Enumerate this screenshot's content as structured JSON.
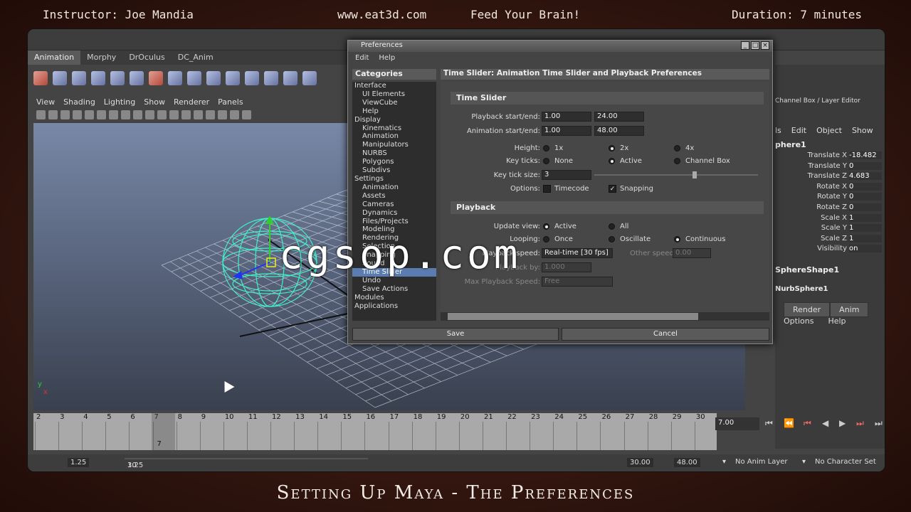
{
  "banner": {
    "instructor": "Instructor: Joe Mandia",
    "site": "www.eat3d.com",
    "tagline": "Feed Your Brain!",
    "duration": "Duration: 7 minutes",
    "lesson_title": "Setting Up Maya - The Preferences"
  },
  "watermark": "cgsop.com",
  "maya": {
    "shelf_tabs": [
      "Animation",
      "Morphy",
      "DrOculus",
      "DC_Anim"
    ],
    "active_shelf": "Animation",
    "viewport_menu": [
      "View",
      "Shading",
      "Lighting",
      "Show",
      "Renderer",
      "Panels"
    ],
    "axis_y": "y",
    "axis_x": "x",
    "channel_box": {
      "title": "Channel Box / Layer Editor",
      "menu": [
        "ls",
        "Edit",
        "Object",
        "Show"
      ],
      "object_name": "phere1",
      "attributes": [
        {
          "name": "Translate X",
          "value": "-18.482"
        },
        {
          "name": "Translate Y",
          "value": "0"
        },
        {
          "name": "Translate Z",
          "value": "4.683"
        },
        {
          "name": "Rotate X",
          "value": "0"
        },
        {
          "name": "Rotate Y",
          "value": "0"
        },
        {
          "name": "Rotate Z",
          "value": "0"
        },
        {
          "name": "Scale X",
          "value": "1"
        },
        {
          "name": "Scale Y",
          "value": "1"
        },
        {
          "name": "Scale Z",
          "value": "1"
        },
        {
          "name": "Visibility",
          "value": "on"
        }
      ],
      "shape_name": "SphereShape1",
      "input_name": "NurbSphere1"
    },
    "layer_editor": {
      "tabs": [
        "Render",
        "Anim"
      ],
      "menu": [
        "Options",
        "Help"
      ]
    },
    "timeline": {
      "ticks": [
        "2",
        "3",
        "4",
        "5",
        "6",
        "7",
        "8",
        "9",
        "10",
        "11",
        "12",
        "13",
        "14",
        "15",
        "16",
        "17",
        "18",
        "19",
        "20",
        "21",
        "22",
        "23",
        "24",
        "25",
        "26",
        "27",
        "28",
        "29",
        "30"
      ],
      "current_frame": "7",
      "current_frame_field": "7.00"
    },
    "range_slider": {
      "start": "1.25",
      "inner_start": "1.25",
      "inner_end": "30",
      "end": "30.00",
      "anim_end": "48.00",
      "anim_layer": "No Anim Layer",
      "character_set": "No Character Set"
    }
  },
  "preferences": {
    "title": "Preferences",
    "menu": [
      "Edit",
      "Help"
    ],
    "categories_header": "Categories",
    "categories": [
      {
        "label": "Interface",
        "sub": false
      },
      {
        "label": "UI Elements",
        "sub": true
      },
      {
        "label": "ViewCube",
        "sub": true
      },
      {
        "label": "Help",
        "sub": true
      },
      {
        "label": "Display",
        "sub": false
      },
      {
        "label": "Kinematics",
        "sub": true
      },
      {
        "label": "Animation",
        "sub": true
      },
      {
        "label": "Manipulators",
        "sub": true
      },
      {
        "label": "NURBS",
        "sub": true
      },
      {
        "label": "Polygons",
        "sub": true
      },
      {
        "label": "Subdivs",
        "sub": true
      },
      {
        "label": "Settings",
        "sub": false
      },
      {
        "label": "Animation",
        "sub": true
      },
      {
        "label": "Assets",
        "sub": true
      },
      {
        "label": "Cameras",
        "sub": true
      },
      {
        "label": "Dynamics",
        "sub": true
      },
      {
        "label": "Files/Projects",
        "sub": true
      },
      {
        "label": "Modeling",
        "sub": true
      },
      {
        "label": "Rendering",
        "sub": true
      },
      {
        "label": "Selection",
        "sub": true
      },
      {
        "label": "Snapping",
        "sub": true
      },
      {
        "label": "Sound",
        "sub": true
      },
      {
        "label": "Time Slider",
        "sub": true,
        "selected": true
      },
      {
        "label": "Undo",
        "sub": true
      },
      {
        "label": "Save Actions",
        "sub": true
      },
      {
        "label": "Modules",
        "sub": false
      },
      {
        "label": "Applications",
        "sub": false
      }
    ],
    "section_header": "Time Slider: Animation Time Slider and Playback Preferences",
    "time_slider": {
      "header": "Time Slider",
      "playback_label": "Playback start/end:",
      "playback_start": "1.00",
      "playback_end": "24.00",
      "animation_label": "Animation start/end:",
      "animation_start": "1.00",
      "animation_end": "48.00",
      "height_label": "Height:",
      "height_options": [
        "1x",
        "2x",
        "4x"
      ],
      "height_selected": 1,
      "key_ticks_label": "Key ticks:",
      "key_ticks_options": [
        "None",
        "Active",
        "Channel Box"
      ],
      "key_ticks_selected": 1,
      "key_tick_size_label": "Key tick size:",
      "key_tick_size": "3",
      "options_label": "Options:",
      "timecode": "Timecode",
      "snapping": "Snapping"
    },
    "playback": {
      "header": "Playback",
      "update_view_label": "Update view:",
      "update_options": [
        "Active",
        "All"
      ],
      "update_selected": 0,
      "looping_label": "Looping:",
      "looping_options": [
        "Once",
        "Oscillate",
        "Continuous"
      ],
      "looping_selected": 2,
      "playback_speed_label": "Playback speed:",
      "playback_speed_value": "Real-time [30 fps]",
      "other_speed_label": "Other speed:",
      "other_speed_value": "0.00",
      "playback_by_label": "Playback by:",
      "playback_by_value": "1.000",
      "max_speed_label": "Max Playback Speed:",
      "max_speed_value": "Free"
    },
    "save_label": "Save",
    "cancel_label": "Cancel"
  }
}
